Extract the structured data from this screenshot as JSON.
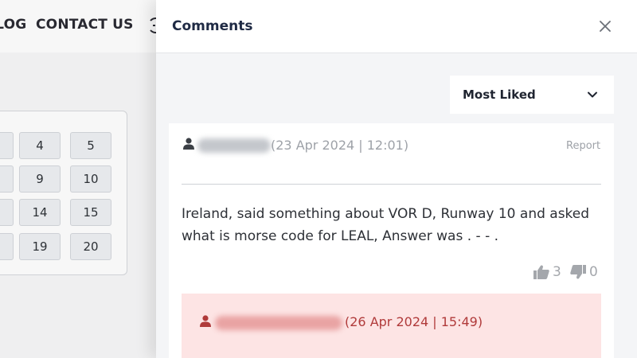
{
  "background": {
    "nav": {
      "items": [
        {
          "label": "BLOG"
        },
        {
          "label": "CONTACT US"
        }
      ]
    },
    "number_grid": {
      "rows": [
        [
          "4",
          "5"
        ],
        [
          "9",
          "10"
        ],
        [
          "14",
          "15"
        ],
        [
          "19",
          "20"
        ]
      ]
    }
  },
  "panel": {
    "title": "Comments",
    "close_icon": "close-icon",
    "sort": {
      "selected": "Most Liked",
      "icon": "chevron-down-icon"
    },
    "comments": [
      {
        "author_redacted": true,
        "timestamp": "(23 Apr 2024 | 12:01)",
        "report_label": "Report",
        "body": "Ireland, said something about VOR D, Runway 10 and asked what is morse code for LEAL, Answer was . - - .",
        "likes": "3",
        "dislikes": "0",
        "replies": [
          {
            "author_redacted": true,
            "timestamp": "(26 Apr 2024 | 15:49)"
          }
        ]
      }
    ]
  },
  "colors": {
    "title": "#1f2a44",
    "muted": "#9ea2a8",
    "reply_background": "#fde4e4",
    "reply_text": "#b03a3a"
  }
}
